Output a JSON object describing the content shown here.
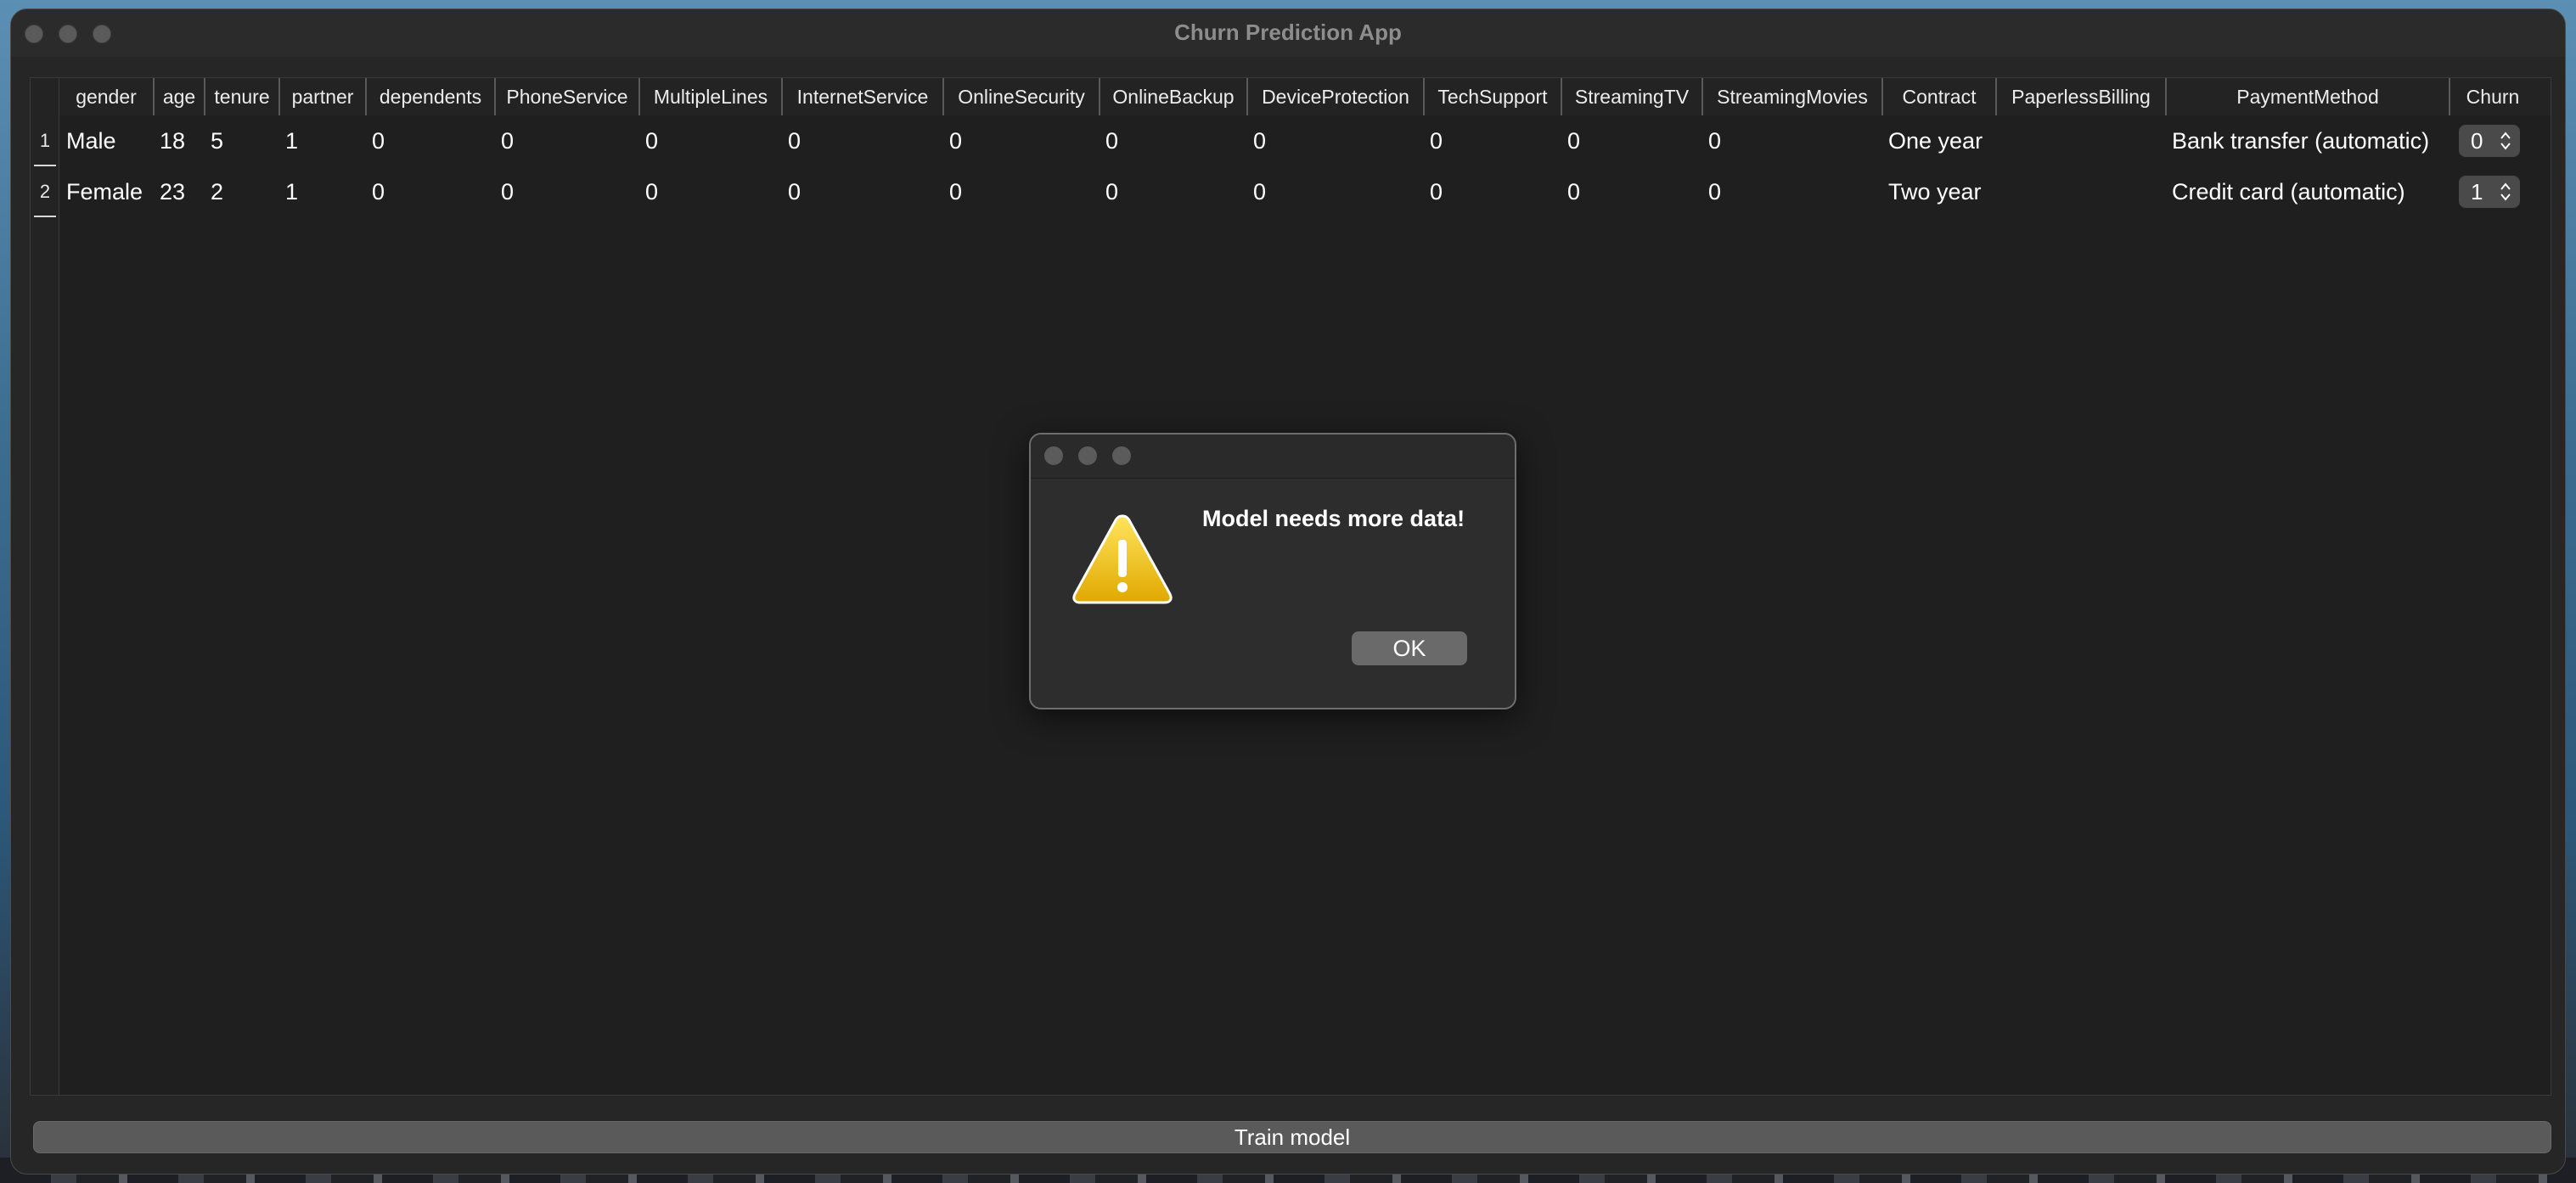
{
  "window": {
    "title": "Churn Prediction App"
  },
  "table": {
    "columns": [
      "gender",
      "age",
      "tenure",
      "partner",
      "dependents",
      "PhoneService",
      "MultipleLines",
      "InternetService",
      "OnlineSecurity",
      "OnlineBackup",
      "DeviceProtection",
      "TechSupport",
      "StreamingTV",
      "StreamingMovies",
      "Contract",
      "PaperlessBilling",
      "PaymentMethod",
      "Churn"
    ],
    "row_numbers": [
      "1",
      "2"
    ],
    "rows": [
      [
        "Male",
        "18",
        "5",
        "1",
        "0",
        "0",
        "0",
        "0",
        "0",
        "0",
        "0",
        "0",
        "0",
        "0",
        "One year",
        "",
        "Bank transfer (automatic)",
        "0"
      ],
      [
        "Female",
        "23",
        "2",
        "1",
        "0",
        "0",
        "0",
        "0",
        "0",
        "0",
        "0",
        "0",
        "0",
        "0",
        "Two year",
        "",
        "Credit card (automatic)",
        "1"
      ]
    ]
  },
  "footer": {
    "train_label": "Train model"
  },
  "dialog": {
    "message": "Model needs more data!",
    "ok_label": "OK",
    "icon": "warning-icon"
  }
}
